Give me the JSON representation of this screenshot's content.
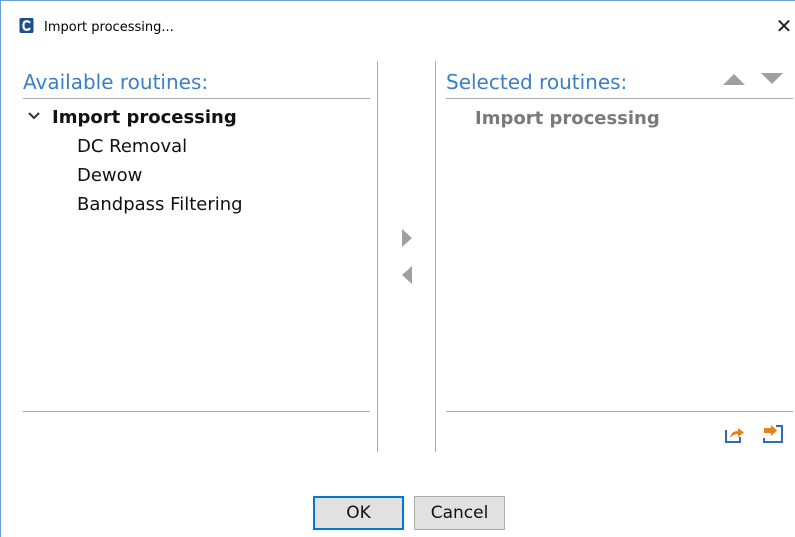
{
  "window": {
    "title": "Import processing...",
    "close_glyph": "✕"
  },
  "available": {
    "header": "Available routines:",
    "tree": {
      "group_label": "Import processing",
      "children": [
        {
          "label": "DC Removal"
        },
        {
          "label": "Dewow"
        },
        {
          "label": "Bandpass Filtering"
        }
      ]
    }
  },
  "selected": {
    "header": "Selected routines:",
    "items": [
      {
        "label": "Import processing"
      }
    ]
  },
  "icons": {
    "app": "app-logo-icon",
    "move_up": "triangle-up-icon",
    "move_down": "triangle-down-icon",
    "add": "triangle-right-icon",
    "remove": "triangle-left-icon",
    "export": "export-icon",
    "import": "import-icon"
  },
  "colors": {
    "accent": "#3c7fc4",
    "icon_gray": "#a0a0a0",
    "icon_orange": "#e8801e",
    "frame_blue": "#2f6db3",
    "primary_border": "#0078d7"
  },
  "buttons": {
    "ok_label": "OK",
    "cancel_label": "Cancel"
  }
}
